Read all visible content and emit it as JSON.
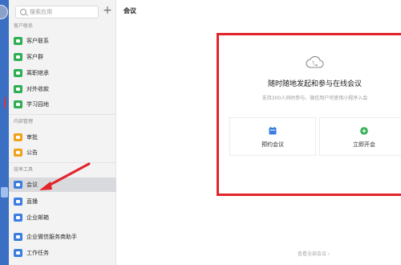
{
  "search": {
    "placeholder": "搜索应用",
    "add_symbol": "+"
  },
  "sections": {
    "customer": "客户联系",
    "internal": "内部管理",
    "efficiency": "效率工具"
  },
  "sidebar": {
    "customer_items": [
      {
        "label": "客户联系",
        "icon": "customer-contact-icon",
        "color": "#2fae52"
      },
      {
        "label": "客户群",
        "icon": "customer-group-icon",
        "color": "#2fae52"
      },
      {
        "label": "离职继承",
        "icon": "resign-inherit-icon",
        "color": "#2fae52"
      },
      {
        "label": "对外收款",
        "icon": "payment-icon",
        "color": "#2fae52"
      },
      {
        "label": "学习园地",
        "icon": "study-icon",
        "color": "#2fae52"
      }
    ],
    "internal_items": [
      {
        "label": "审批",
        "icon": "approval-icon",
        "color": "#f0a21b"
      },
      {
        "label": "公告",
        "icon": "announcement-icon",
        "color": "#f0a21b"
      }
    ],
    "efficiency_items": [
      {
        "label": "会议",
        "icon": "meeting-icon",
        "color": "#3b7ee0",
        "active": true
      },
      {
        "label": "直播",
        "icon": "live-icon",
        "color": "#3b7ee0"
      },
      {
        "label": "企业邮箱",
        "icon": "mail-icon",
        "color": "#3b7ee0"
      },
      {
        "label": "企业微信服务商助手",
        "icon": "service-assistant-icon",
        "color": "#3b7ee0"
      },
      {
        "label": "工作任务",
        "icon": "task-icon",
        "color": "#3b7ee0"
      }
    ]
  },
  "main": {
    "title": "会议",
    "headline": "随时随地发起和参与在线会议",
    "subtext": "支持300人同时参与、微信用户可使用小程序入会",
    "schedule_label": "预约会议",
    "start_label": "立即开会",
    "footer_link": "查看全部会议 ›"
  },
  "colors": {
    "accent_blue": "#3b7ee0",
    "highlight_red": "#e3242b",
    "green": "#2fae52",
    "orange": "#f0a21b"
  }
}
